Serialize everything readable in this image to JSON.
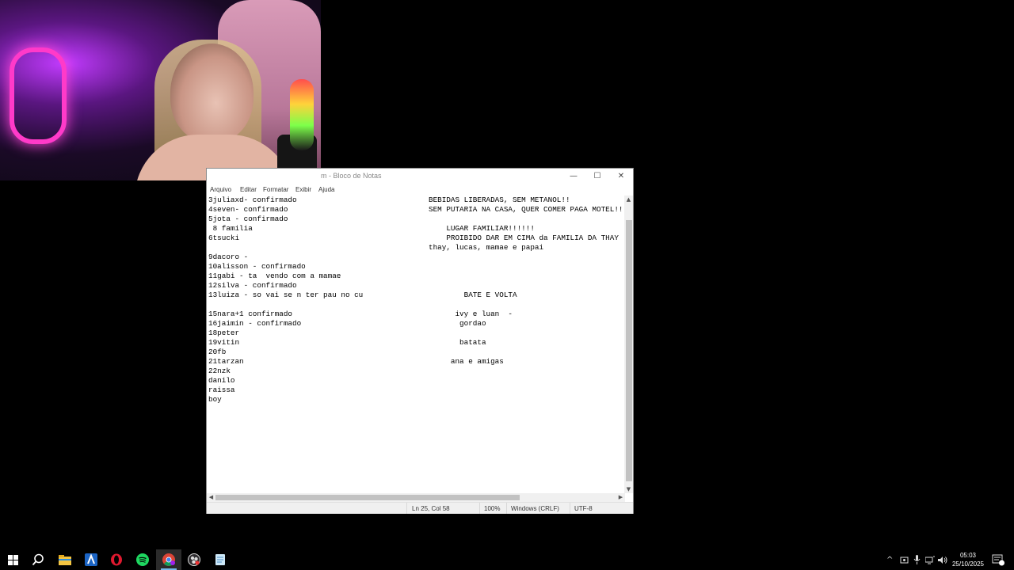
{
  "notepad": {
    "title": "m - Bloco de Notas",
    "menu": [
      "Arquivo",
      "Editar",
      "Formatar",
      "Exibir",
      "Ajuda"
    ],
    "window_controls": {
      "minimize": "—",
      "maximize": "☐",
      "close": "✕"
    },
    "left_lines": [
      "3juliaxd- confirmado",
      "4seven- confirmado",
      "5jota - confirmado",
      " 8 familia",
      "6tsucki",
      "",
      "9dacoro -",
      "10alisson - confirmado",
      "11gabi - ta  vendo com a mamae",
      "12silva - confirmado",
      "13luiza - so vai se n ter pau no cu",
      "",
      "15nara+1 confirmado",
      "16jaimin - confirmado",
      "18peter",
      "19vitin",
      "20fb",
      "21tarzan",
      "22nzk",
      "danilo",
      "raissa",
      "boy"
    ],
    "right_lines": [
      "BEBIDAS LIBERADAS, SEM METANOL!!",
      "SEM PUTARIA NA CASA, QUER COMER PAGA MOTEL!!!",
      "",
      "    LUGAR FAMILIAR!!!!!!",
      "    PROIBIDO DAR EM CIMA da FAMILIA DA THAY !!",
      "thay, lucas, mamae e papai",
      "",
      "",
      "",
      "",
      "        BATE E VOLTA",
      "",
      "      ivy e luan  -",
      "       gordao",
      "",
      "       batata",
      "",
      "     ana e amigas"
    ],
    "status": {
      "position": "Ln 25, Col 58",
      "zoom": "100%",
      "line_ending": "Windows (CRLF)",
      "encoding": "UTF-8"
    }
  },
  "taskbar": {
    "icons": [
      "windows-start-icon",
      "search-icon",
      "file-explorer-icon",
      "app-a-icon",
      "opera-icon",
      "spotify-icon",
      "chrome-icon",
      "obs-icon",
      "notepad-icon"
    ],
    "active_icon": "chrome-icon",
    "tray": {
      "chevron": "^",
      "badge": "11"
    },
    "time": "05:03",
    "date": "25/10/2025"
  }
}
